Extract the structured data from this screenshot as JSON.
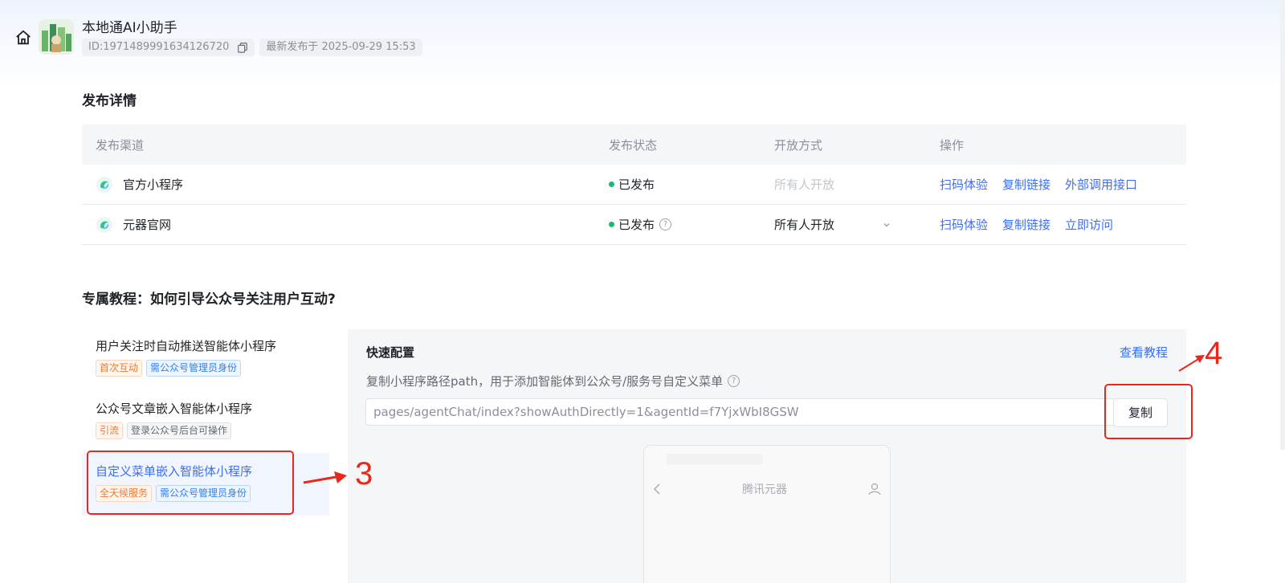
{
  "header": {
    "app_name": "本地通AI小助手",
    "id_text": "ID:1971489991634126720",
    "publish_time": "最新发布于 2025-09-29 15:53",
    "icons": [
      "home-icon",
      "copy-icon"
    ]
  },
  "publish": {
    "section_title": "发布详情",
    "columns": [
      "发布渠道",
      "发布状态",
      "开放方式",
      "操作"
    ],
    "rows": [
      {
        "channel": "官方小程序",
        "status": "已发布",
        "access": "所有人开放",
        "access_disabled": true,
        "actions": [
          "扫码体验",
          "复制链接",
          "外部调用接口"
        ]
      },
      {
        "channel": "元器官网",
        "status": "已发布",
        "has_help": true,
        "access": "所有人开放",
        "access_disabled": false,
        "actions": [
          "扫码体验",
          "复制链接",
          "立即访问"
        ]
      }
    ]
  },
  "tutorial": {
    "section_title": "专属教程：如何引导公众号关注用户互动?",
    "items": [
      {
        "title": "用户关注时自动推送智能体小程序",
        "tags": [
          {
            "text": "首次互动",
            "color": "orange"
          },
          {
            "text": "需公众号管理员身份",
            "color": "blue"
          }
        ]
      },
      {
        "title": "公众号文章嵌入智能体小程序",
        "tags": [
          {
            "text": "引流",
            "color": "orange"
          },
          {
            "text": "登录公众号后台可操作",
            "color": "gray"
          }
        ]
      },
      {
        "title": "自定义菜单嵌入智能体小程序",
        "active": true,
        "tags": [
          {
            "text": "全天候服务",
            "color": "orange"
          },
          {
            "text": "需公众号管理员身份",
            "color": "blue"
          }
        ]
      }
    ],
    "panel": {
      "title": "快速配置",
      "tutorial_link": "查看教程",
      "description": "复制小程序路径path，用于添加智能体到公众号/服务号自定义菜单",
      "path_value": "pages/agentChat/index?showAuthDirectly=1&agentId=f7YjxWbI8GSW",
      "copy_label": "复制",
      "phone_title": "腾讯元器"
    }
  },
  "annotations": {
    "label_3": "3",
    "label_4": "4"
  },
  "colors": {
    "accent": "#3b6ef5",
    "published": "#22b573",
    "annotation": "#e8281c"
  }
}
